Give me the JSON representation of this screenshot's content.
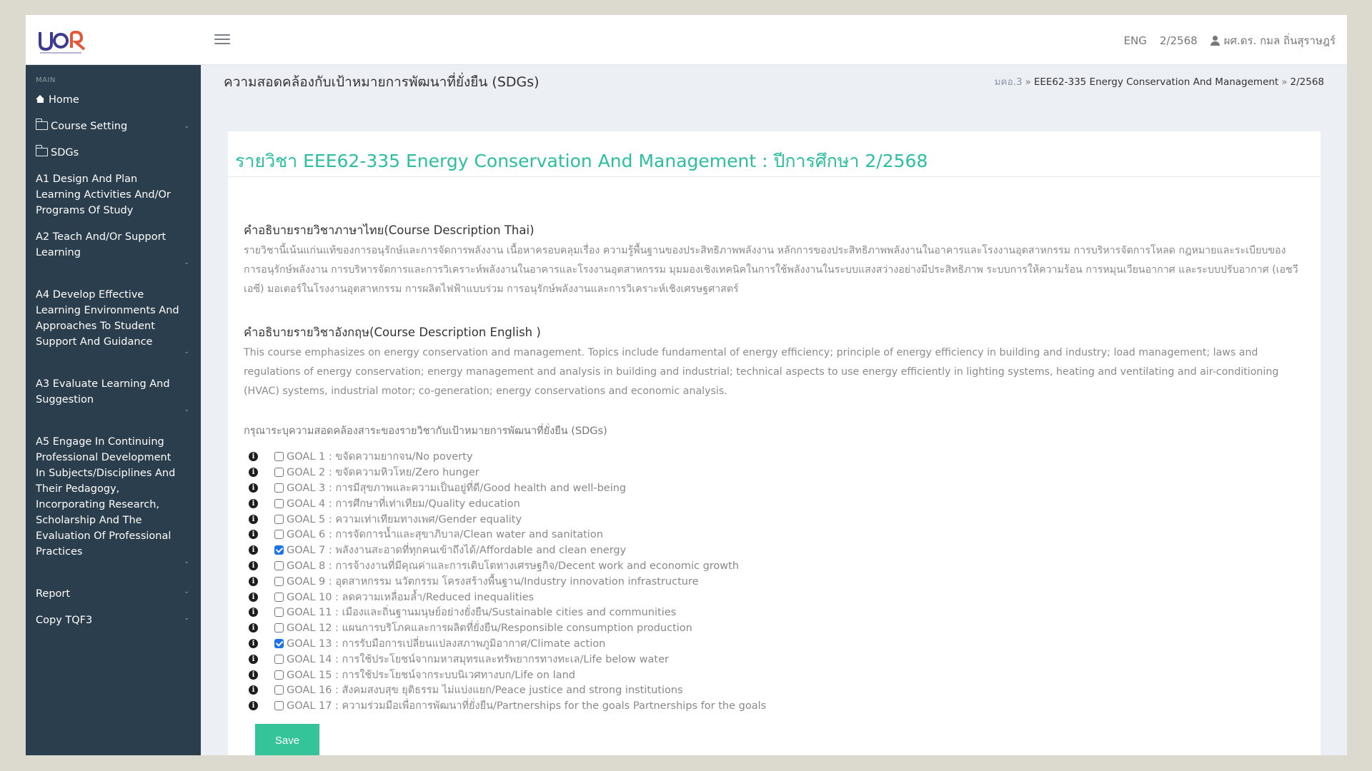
{
  "header": {
    "lang": "ENG",
    "term": "2/2568",
    "user": "ผศ.ดร. กมล ถิ่นสุราษฎร์"
  },
  "sidebar": {
    "section": "MAIN",
    "items": [
      {
        "label": "Home"
      },
      {
        "label": "Course Setting"
      },
      {
        "label": "SDGs"
      },
      {
        "label": "A1 Design And Plan Learning Activities And/Or Programs Of Study"
      },
      {
        "label": "A2 Teach And/Or Support Learning"
      },
      {
        "label": "A4 Develop Effective Learning Environments And Approaches To Student Support And Guidance"
      },
      {
        "label": "A3 Evaluate Learning And Suggestion"
      },
      {
        "label": "A5 Engage In Continuing Professional Development In Subjects/Disciplines And Their Pedagogy, Incorporating Research, Scholarship And The Evaluation Of Professional Practices"
      },
      {
        "label": "Report"
      },
      {
        "label": "Copy TQF3"
      }
    ]
  },
  "page": {
    "title": "ความสอดคล้องกับเป้าหมายการพัฒนาที่ยั่งยืน (SDGs)",
    "breadcrumb": [
      "มคอ.3",
      "EEE62-335 Energy Conservation And Management",
      "2/2568"
    ],
    "breadcrumb_sep": "»"
  },
  "panel": {
    "heading": "รายวิชา EEE62-335 Energy Conservation And Management : ปีการศึกษา 2/2568",
    "thai_title": "คำอธิบายรายวิชาภาษาไทย(Course Description Thai)",
    "thai_desc": "รายวิชานี้เน้นแก่นแท้ของการอนุรักษ์และการจัดการพลังงาน เนื้อหาครอบคลุมเรื่อง ความรู้พื้นฐานของประสิทธิภาพพลังงาน หลักการของประสิทธิภาพพลังงานในอาคารและโรงงานอุตสาหกรรม การบริหารจัดการโหลด กฎหมายและระเบียบของการอนุรักษ์พลังงาน การบริหารจัดการและการวิเคราะห์พลังงานในอาคารและโรงงานอุตสาหกรรม มุมมองเชิงเทคนิคในการใช้พลังงานในระบบแสงสว่างอย่างมีประสิทธิภาพ ระบบการให้ความร้อน การหมุนเวียนอากาศ และระบบปรับอากาศ (เอชวีเอซี) มอเตอร์ในโรงงานอุตสาหกรรม การผลิตไฟฟ้าแบบร่วม การอนุรักษ์พลังงานและการวิเคราะห์เชิงเศรษฐศาสตร์",
    "eng_title": "คำอธิบายรายวิชาอังกฤษ(Course Description English )",
    "eng_desc": "This course emphasizes on energy conservation and management. Topics include fundamental of energy efficiency; principle of energy efficiency in building and industry; load management; laws and regulations of energy conservation; energy management and analysis in building and industrial; technical aspects to use energy efficiently in lighting systems, heating and ventilating and air-conditioning (HVAC) systems, industrial motor; co-generation; energy conservations and economic analysis.",
    "prompt": "กรุณาระบุความสอดคล้องสาระของรายวิชากับเป้าหมายการพัฒนาที่ยั่งยืน (SDGs)",
    "goals": [
      {
        "label": "GOAL 1 : ขจัดความยากจน/No poverty",
        "checked": false
      },
      {
        "label": "GOAL 2 : ขจัดความหิวโหย/Zero hunger",
        "checked": false
      },
      {
        "label": "GOAL 3 : การมีสุขภาพและความเป็นอยู่ที่ดี/Good health and well-being",
        "checked": false
      },
      {
        "label": "GOAL 4 : การศึกษาที่เท่าเทียม/Quality education",
        "checked": false
      },
      {
        "label": "GOAL 5 : ความเท่าเทียมทางเพศ/Gender equality",
        "checked": false
      },
      {
        "label": "GOAL 6 : การจัดการน้ำและสุขาภิบาล/Clean water and sanitation",
        "checked": false
      },
      {
        "label": "GOAL 7 : พลังงานสะอาดที่ทุกคนเข้าถึงได้/Affordable and clean energy",
        "checked": true
      },
      {
        "label": "GOAL 8 : การจ้างงานที่มีคุณค่าและการเติบโตทางเศรษฐกิจ/Decent work and economic growth",
        "checked": false
      },
      {
        "label": "GOAL 9 : อุตสาหกรรม นวัตกรรม โครงสร้างพื้นฐาน/Industry innovation infrastructure",
        "checked": false
      },
      {
        "label": "GOAL 10 : ลดความเหลื่อมล้ำ/Reduced inequalities",
        "checked": false
      },
      {
        "label": "GOAL 11 : เมืองและถิ่นฐานมนุษย์อย่างยั่งยืน/Sustainable cities and communities",
        "checked": false
      },
      {
        "label": "GOAL 12 : แผนการบริโภคและการผลิตที่ยั่งยืน/Responsible consumption production",
        "checked": false
      },
      {
        "label": "GOAL 13 : การรับมือการเปลี่ยนแปลงสภาพภูมิอากาศ/Climate action",
        "checked": true
      },
      {
        "label": "GOAL 14 : การใช้ประโยชน์จากมหาสมุทรและทรัพยากรทางทะเล/Life below water",
        "checked": false
      },
      {
        "label": "GOAL 15 : การใช้ประโยชน์จากระบบนิเวศทางบก/Life on land",
        "checked": false
      },
      {
        "label": "GOAL 16 : สังคมสงบสุข ยุติธรรม ไม่แบ่งแยก/Peace justice and strong institutions",
        "checked": false
      },
      {
        "label": "GOAL 17 : ความร่วมมือเพื่อการพัฒนาที่ยั่งยืน/Partnerships for the goals Partnerships for the goals",
        "checked": false
      }
    ],
    "save_label": "Save"
  },
  "icons": {
    "info": "info-circle-icon",
    "home": "home-icon",
    "folder": "folder-icon",
    "user": "user-icon",
    "menu": "hamburger-menu-icon"
  },
  "colors": {
    "sidebar_bg": "#2b3e4d",
    "heading": "#2bbfa0",
    "save_button": "#35c49a",
    "checkbox_checked": "#1a73e8"
  }
}
